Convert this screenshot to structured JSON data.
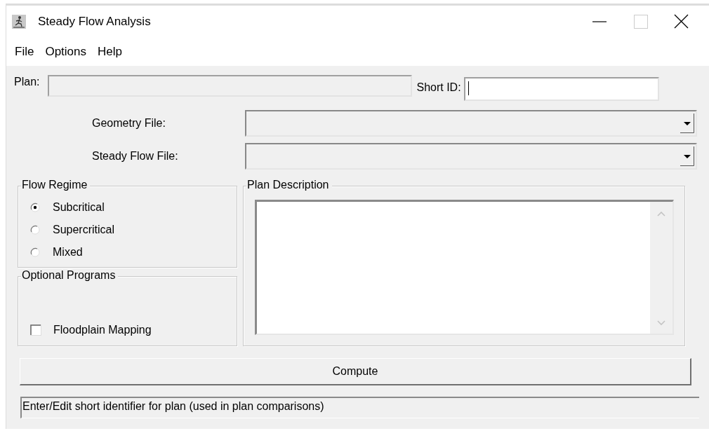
{
  "window": {
    "title": "Steady Flow Analysis"
  },
  "menu": [
    {
      "label": "File"
    },
    {
      "label": "Options"
    },
    {
      "label": "Help"
    }
  ],
  "plan": {
    "label": "Plan:",
    "disabled": true
  },
  "short_id": {
    "label": "Short ID:",
    "disabled": false
  },
  "files": [
    {
      "label": "Geometry File:",
      "disabled": true
    },
    {
      "label": "Steady Flow File:",
      "disabled": true
    }
  ],
  "flow_regime": {
    "title": "Flow Regime",
    "options": [
      {
        "label": "Subcritical",
        "selected": true
      },
      {
        "label": "Supercritical",
        "selected": false
      },
      {
        "label": "Mixed",
        "selected": false
      }
    ]
  },
  "optional_programs": {
    "title": "Optional Programs",
    "options": [
      {
        "label": "Floodplain Mapping",
        "checked": false
      }
    ]
  },
  "plan_description": {
    "title": "Plan Description"
  },
  "compute_button": "Compute",
  "status_bar": "Enter/Edit short identifier for plan (used in plan comparisons)"
}
